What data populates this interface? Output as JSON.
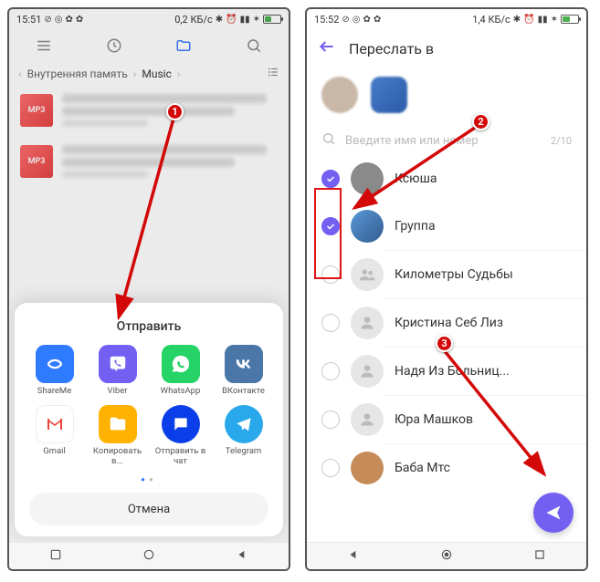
{
  "left": {
    "status": {
      "time": "15:51",
      "net": "0,2 КБ/с"
    },
    "tabs": {
      "active": "folder"
    },
    "breadcrumb": {
      "root": "Внутренняя память",
      "folder": "Music"
    },
    "files": [
      {
        "badge": "MP3"
      },
      {
        "badge": "MP3"
      }
    ],
    "share": {
      "title": "Отправить",
      "apps": [
        {
          "name": "ShareMe"
        },
        {
          "name": "Viber"
        },
        {
          "name": "WhatsApp"
        },
        {
          "name": "ВКонтакте"
        },
        {
          "name": "Gmail"
        },
        {
          "name": "Копировать в..."
        },
        {
          "name": "Отправить в чат"
        },
        {
          "name": "Telegram"
        }
      ],
      "cancel": "Отмена"
    }
  },
  "right": {
    "status": {
      "time": "15:52",
      "net": "1,4 КБ/с"
    },
    "title": "Переслать в",
    "search": {
      "placeholder": "Введите имя или номер",
      "count": "2/10"
    },
    "contacts": [
      {
        "name": "Ксюша",
        "selected": true
      },
      {
        "name": "Группа",
        "selected": true
      },
      {
        "name": "Километры Судьбы",
        "selected": false
      },
      {
        "name": "Кристина Себ Лиз",
        "selected": false
      },
      {
        "name": "Надя Из Больниц...",
        "selected": false
      },
      {
        "name": "Юра Машков",
        "selected": false
      },
      {
        "name": "Баба Мтс",
        "selected": false
      }
    ]
  },
  "markers": {
    "m1": "1",
    "m2": "2",
    "m3": "3"
  }
}
